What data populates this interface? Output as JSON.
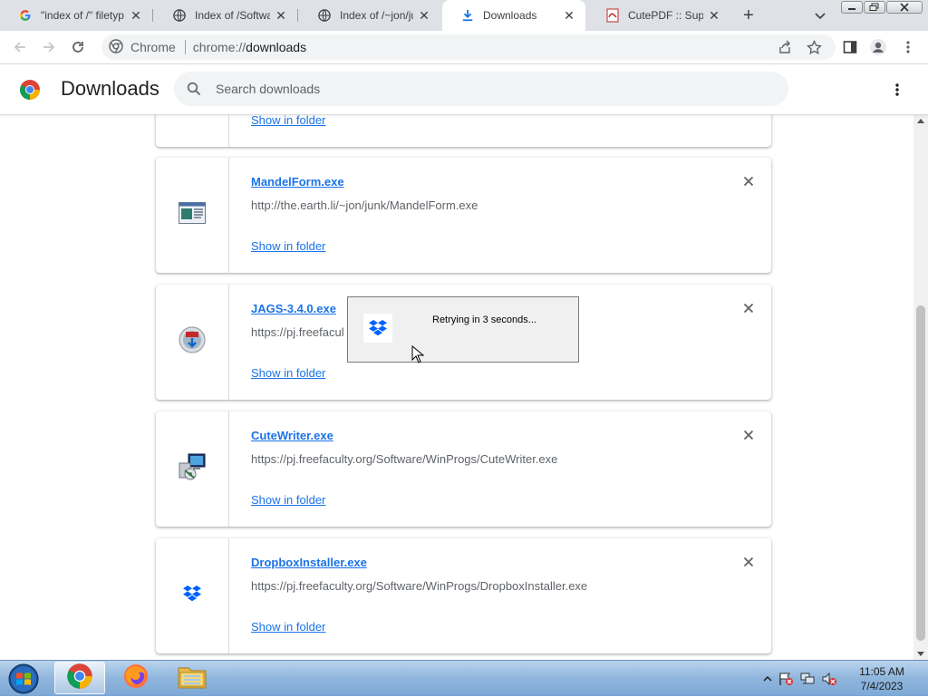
{
  "tabs": [
    {
      "title": "\"index of /\" filetyp",
      "icon": "google-icon"
    },
    {
      "title": "Index of /Softwar",
      "icon": "globe-icon"
    },
    {
      "title": "Index of /~jon/jun",
      "icon": "globe-icon"
    },
    {
      "title": "Downloads",
      "icon": "download-icon",
      "active": true
    },
    {
      "title": "CutePDF :: Suppor",
      "icon": "cutepdf-icon"
    }
  ],
  "toolbar": {
    "site_chip": "Chrome",
    "url_scheme": "chrome://",
    "url_host": "downloads"
  },
  "header": {
    "title": "Downloads",
    "search_placeholder": "Search downloads"
  },
  "downloads": [
    {
      "name": "",
      "url": "",
      "show_label": "Show in folder",
      "icon": "generic-file-icon"
    },
    {
      "name": "MandelForm.exe",
      "url": "http://the.earth.li/~jon/junk/MandelForm.exe",
      "show_label": "Show in folder",
      "icon": "window-app-icon"
    },
    {
      "name": "JAGS-3.4.0.exe",
      "url": "https://pj.freefacul",
      "show_label": "Show in folder",
      "icon": "installer-globe-icon"
    },
    {
      "name": "CuteWriter.exe",
      "url": "https://pj.freefaculty.org/Software/WinProgs/CuteWriter.exe",
      "show_label": "Show in folder",
      "icon": "setup-computer-icon"
    },
    {
      "name": "DropboxInstaller.exe",
      "url": "https://pj.freefaculty.org/Software/WinProgs/DropboxInstaller.exe",
      "show_label": "Show in folder",
      "icon": "dropbox-icon"
    }
  ],
  "popup": {
    "message": "Retrying in 3 seconds...",
    "icon": "dropbox-icon"
  },
  "taskbar": {
    "apps": [
      "chrome-icon",
      "firefox-icon",
      "file-explorer-icon"
    ],
    "time": "11:05 AM",
    "date": "7/4/2023"
  },
  "colors": {
    "link": "#1a73e8",
    "tabstrip": "#dee1e6",
    "dropbox": "#0061fe"
  }
}
